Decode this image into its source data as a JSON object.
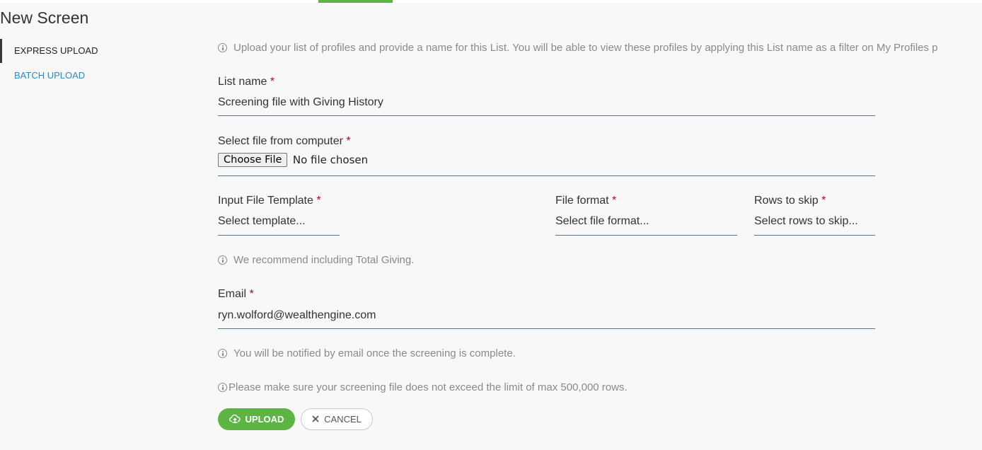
{
  "page": {
    "title": "New Screen"
  },
  "sidebar": {
    "items": [
      {
        "label": "EXPRESS UPLOAD",
        "active": true
      },
      {
        "label": "BATCH UPLOAD",
        "active": false
      }
    ]
  },
  "form": {
    "intro_text": "Upload your list of profiles and provide a name for this List. You will be able to view these profiles by applying this List name as a filter on My Profiles p",
    "required_marker": "*",
    "list_name": {
      "label": "List name",
      "value": "Screening file with Giving History"
    },
    "file": {
      "label": "Select file from computer",
      "button_label": "Choose File",
      "status": "No file chosen"
    },
    "template": {
      "label": "Input File Template",
      "placeholder": "Select template..."
    },
    "file_format": {
      "label": "File format",
      "placeholder": "Select file format..."
    },
    "rows_to_skip": {
      "label": "Rows to skip",
      "placeholder": "Select rows to skip..."
    },
    "recommend_text": "We recommend including Total Giving.",
    "email": {
      "label": "Email",
      "value": "ryn.wolford@wealthengine.com"
    },
    "notify_text": "You will be notified by email once the screening is complete.",
    "limit_text": "Please make sure your screening file does not exceed the limit of max 500,000 rows."
  },
  "actions": {
    "upload_label": "UPLOAD",
    "upload_icon": "cloud-upload-icon",
    "cancel_label": "CANCEL",
    "cancel_icon": "close-icon"
  },
  "colors": {
    "accent": "#5cb543",
    "link": "#2a8ac8",
    "required": "#d0021b",
    "field_underline": "#5a7382",
    "muted_text": "#8a8a8a"
  }
}
